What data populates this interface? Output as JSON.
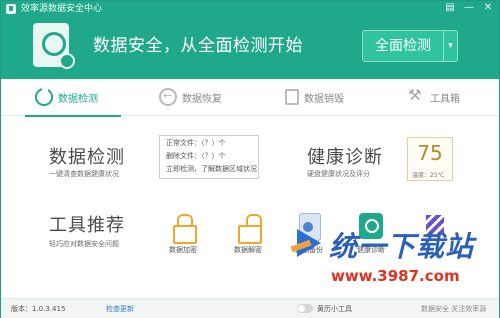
{
  "window": {
    "title": "效率源数据安全中心",
    "controls": [
      "▤",
      "—",
      "✕"
    ]
  },
  "colors": {
    "brand": "#1fa98a",
    "button": "#2fc49e",
    "score": "#b88b1d",
    "link": "#2e7ec8"
  },
  "header": {
    "headline": "数据安全，从全面检测开始",
    "scan_button": "全面检测",
    "scan_dropdown": "▾"
  },
  "tabs": [
    {
      "label": "数据检测",
      "icon": "refresh-icon",
      "active": true
    },
    {
      "label": "数据恢复",
      "icon": "restore-icon",
      "active": false
    },
    {
      "label": "数据销毁",
      "icon": "trash-icon",
      "active": false
    },
    {
      "label": "工具箱",
      "icon": "tools-icon",
      "active": false
    }
  ],
  "detect": {
    "title": "数据检测",
    "subtitle": "一键清查数据健康状况",
    "stats": [
      "正常文件：（？）个",
      "删除文件：（？）个",
      "立即检测，了解数据区域状况"
    ]
  },
  "health": {
    "title": "健康诊断",
    "subtitle": "硬盘健康状况及评分",
    "score": "75",
    "temperature": "温度：25℃"
  },
  "tools": {
    "title": "工具推荐",
    "subtitle": "轻巧应对数据安全问题",
    "items": [
      {
        "label": "数据加密",
        "icon": "lock-icon"
      },
      {
        "label": "数据解密",
        "icon": "unlock-icon"
      },
      {
        "label": "数据备份",
        "icon": "disk-icon"
      },
      {
        "label": "健康诊断",
        "icon": "health-check-icon"
      },
      {
        "label": "",
        "icon": "purple-stripes-icon"
      }
    ]
  },
  "watermark": {
    "title": "统一下载站",
    "url": "www.3987.com"
  },
  "footer": {
    "version": "版本：1.0.3.415",
    "check_update": "检查更新",
    "toggle_label": "黄历小工具",
    "right_text": "数据安全 关注效率源"
  }
}
